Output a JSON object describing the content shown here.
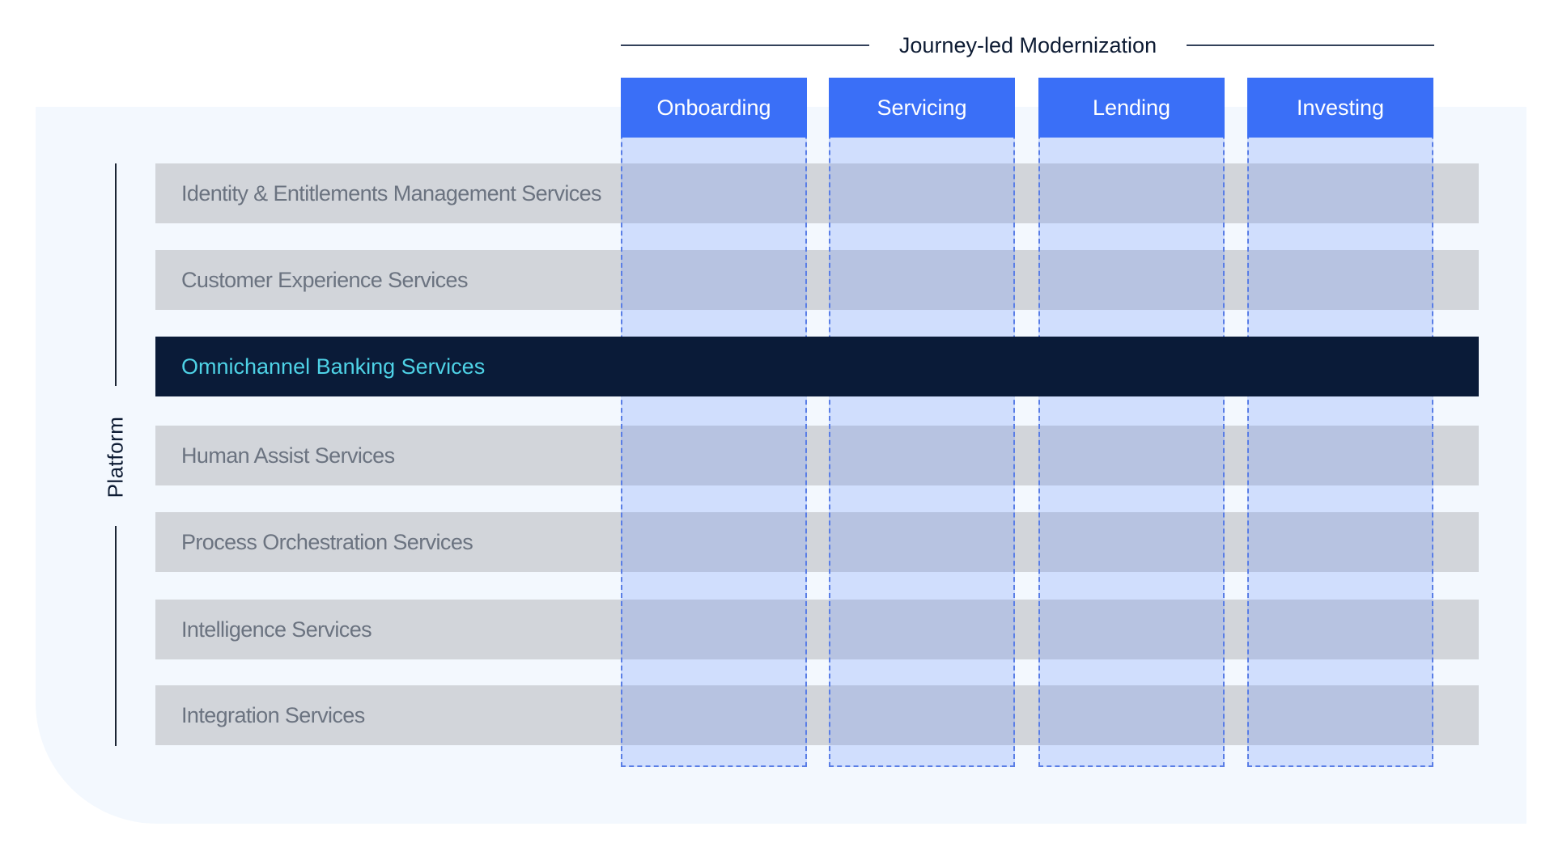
{
  "header": {
    "title": "Journey-led Modernization"
  },
  "axis": {
    "label": "Platform"
  },
  "journeys": [
    {
      "label": "Onboarding"
    },
    {
      "label": "Servicing"
    },
    {
      "label": "Lending"
    },
    {
      "label": "Investing"
    }
  ],
  "services": [
    {
      "label": "Identity & Entitlements Management Services",
      "highlighted": false
    },
    {
      "label": "Customer Experience Services",
      "highlighted": false
    },
    {
      "label": "Omnichannel Banking Services",
      "highlighted": true
    },
    {
      "label": "Human Assist Services",
      "highlighted": false
    },
    {
      "label": "Process Orchestration Services",
      "highlighted": false
    },
    {
      "label": "Intelligence Services",
      "highlighted": false
    },
    {
      "label": "Integration Services",
      "highlighted": false
    }
  ],
  "colors": {
    "journey_header": "#3a6ff7",
    "highlight_row": "#0a1b38",
    "highlight_text": "#4ed2e6",
    "row": "#d2d5da",
    "panel": "#f3f8fe"
  }
}
